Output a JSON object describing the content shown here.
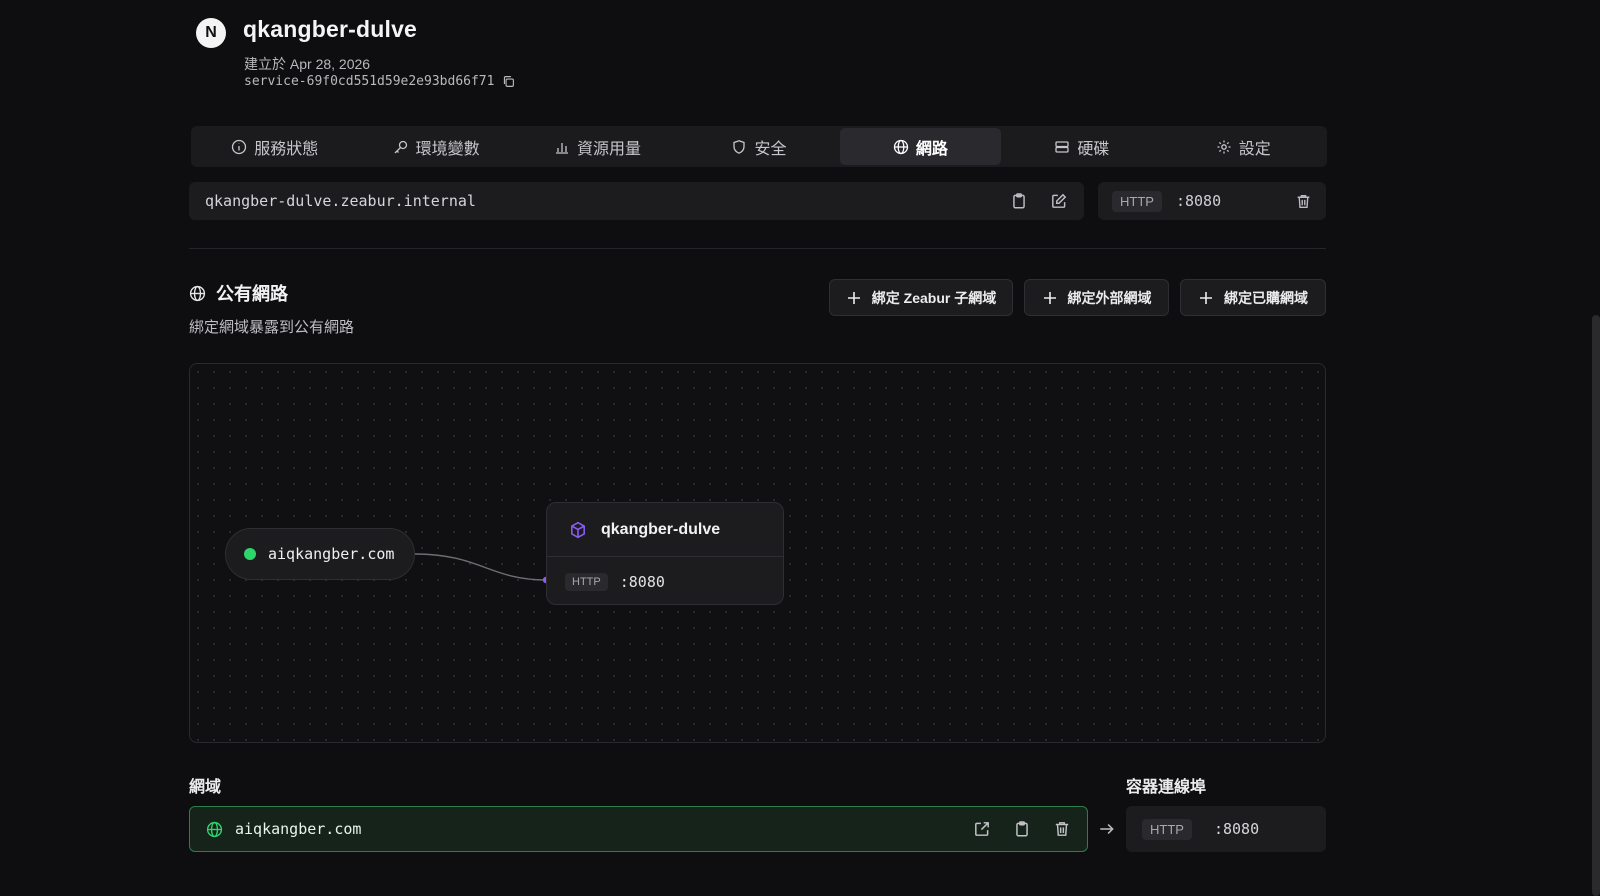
{
  "service": {
    "avatar_letter": "N",
    "name": "qkangber-dulve",
    "created": "建立於 Apr 28, 2026",
    "id": "service-69f0cd551d59e2e93bd66f71"
  },
  "tabs": [
    {
      "label": "服務狀態",
      "icon": "info-icon"
    },
    {
      "label": "環境變數",
      "icon": "key-icon"
    },
    {
      "label": "資源用量",
      "icon": "bar-chart-icon"
    },
    {
      "label": "安全",
      "icon": "shield-icon"
    },
    {
      "label": "網路",
      "icon": "globe-icon",
      "active": true
    },
    {
      "label": "硬碟",
      "icon": "disk-icon"
    },
    {
      "label": "設定",
      "icon": "gear-icon"
    }
  ],
  "internal": {
    "hostname": "qkangber-dulve.zeabur.internal",
    "protocol": "HTTP",
    "port": ":8080"
  },
  "public": {
    "title": "公有網路",
    "subtitle": "綁定網域暴露到公有網路",
    "buttons": {
      "bind_zeabur": "綁定 Zeabur 子網域",
      "bind_external": "綁定外部網域",
      "bind_purchased": "綁定已購網域"
    }
  },
  "graph": {
    "domain": "aiqkangber.com",
    "service_name": "qkangber-dulve",
    "protocol": "HTTP",
    "port": ":8080"
  },
  "domains_section": {
    "label": "網域",
    "domain": "aiqkangber.com",
    "port_label": "容器連線埠",
    "protocol": "HTTP",
    "port": ":8080"
  },
  "colors": {
    "accent_green": "#2fd46b",
    "accent_purple": "#8b5cf6",
    "background": "#0e0e10"
  }
}
